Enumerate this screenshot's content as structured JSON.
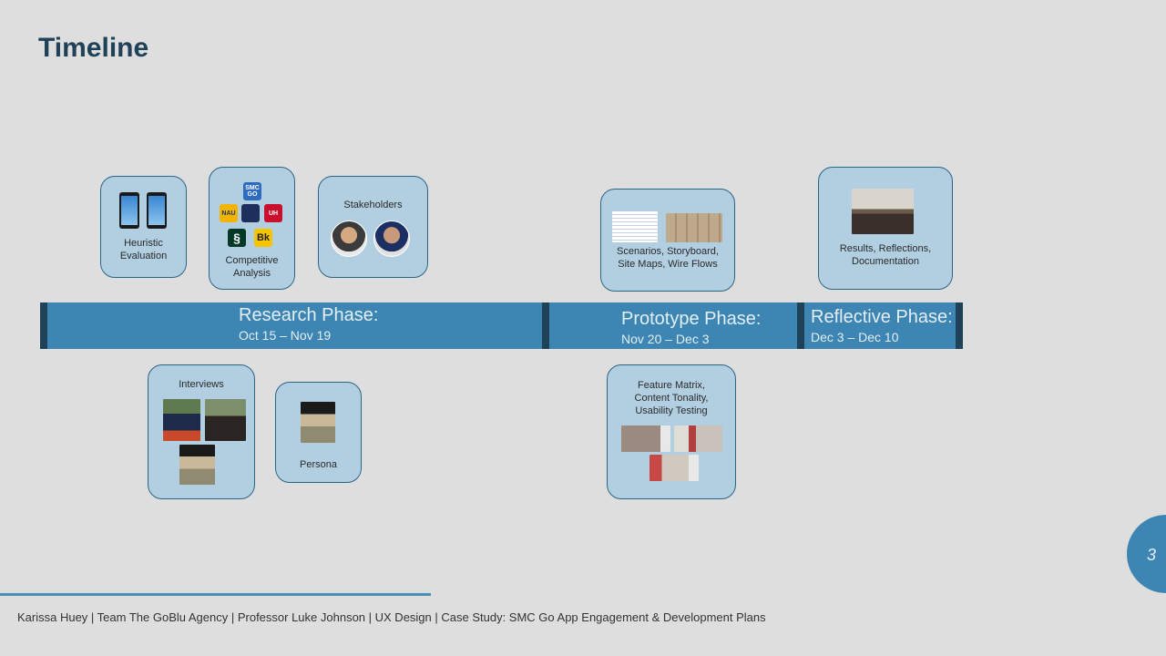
{
  "slide": {
    "title": "Timeline",
    "page_number": "3"
  },
  "phases": [
    {
      "name": "Research Phase:",
      "dates": "Oct 15 – Nov 19"
    },
    {
      "name": "Prototype Phase:",
      "dates": "Nov 20 – Dec 3"
    },
    {
      "name": "Reflective Phase:",
      "dates": "Dec 3 – Dec 10"
    }
  ],
  "cards": {
    "heuristic": "Heuristic Evaluation",
    "competitive": "Competitive Analysis",
    "stakeholders": "Stakeholders",
    "scenarios": "Scenarios, Storyboard, Site Maps, Wire Flows",
    "results": "Results, Reflections, Documentation",
    "interviews": "Interviews",
    "persona": "Persona",
    "feature": "Feature Matrix, Content Tonality, Usability Testing"
  },
  "logos": {
    "smc": "SMC GO",
    "nau": "NAU",
    "uh": "UH",
    "bk": "Bk"
  },
  "footer": {
    "text": "Karissa Huey | Team The GoBlu Agency | Professor Luke Johnson | UX Design | Case Study: SMC Go App Engagement & Development Plans"
  },
  "colors": {
    "background": "#dedede",
    "card_fill": "#b2cfe2",
    "bar": "#3d86b3",
    "bar_end": "#1f4258",
    "title": "#1f4258"
  }
}
